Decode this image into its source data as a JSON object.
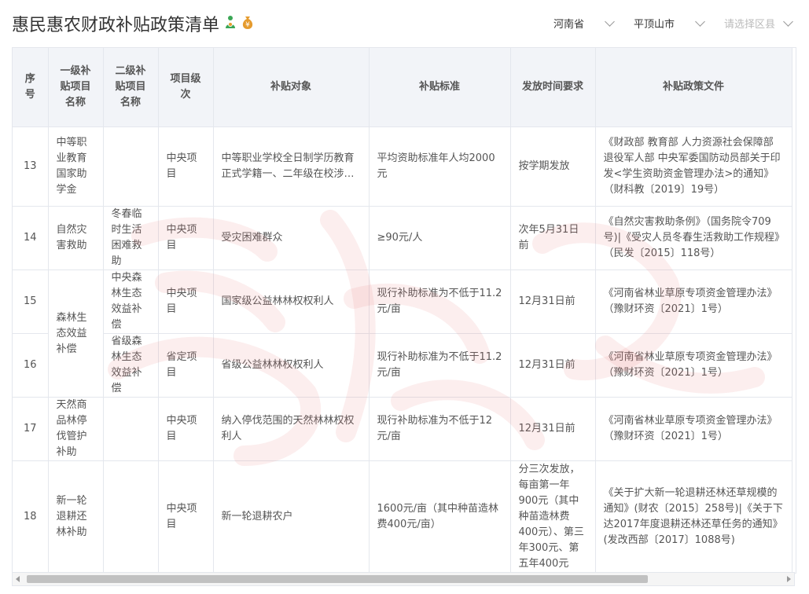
{
  "title": "惠民惠农财政补贴政策清单",
  "filters": {
    "province": "河南省",
    "city": "平顶山市",
    "county_placeholder": "请选择区县"
  },
  "columns": [
    "序号",
    "一级补贴项目名称",
    "二级补贴项目名称",
    "项目级次",
    "补贴对象",
    "补贴标准",
    "发放时间要求",
    "补贴政策文件"
  ],
  "rows": [
    {
      "no": "13",
      "l1": "中等职业教育国家助学金",
      "l2": "",
      "level": "中央项目",
      "target": "中等职业学校全日制学历教育正式学籍一、二年级在校涉农专...",
      "standard": "平均资助标准年人均2000元",
      "time": "按学期发放",
      "doc": "《财政部 教育部 人力资源社会保障部 退役军人部 中央军委国防动员部关于印发<学生资助资金管理办法>的通知》（财科教〔2019〕19号）"
    },
    {
      "no": "14",
      "l1": "自然灾害救助",
      "l2": "冬春临时生活困难救助",
      "level": "中央项目",
      "target": "受灾困难群众",
      "standard": "≥90元/人",
      "time": "次年5月31日前",
      "doc": "《自然灾害救助条例》（国务院令709号)|《受灾人员冬春生活救助工作规程》（民发〔2015〕118号）"
    },
    {
      "no": "15",
      "l1": "森林生态效益补偿",
      "l2": "中央森林生态效益补偿",
      "level": "中央项目",
      "target": "国家级公益林林权权利人",
      "standard": "现行补助标准为不低于11.2元/亩",
      "time": "12月31日前",
      "doc": "《河南省林业草原专项资金管理办法》（豫财环资〔2021〕1号）"
    },
    {
      "no": "16",
      "l1": "",
      "l2": "省级森林生态效益补偿",
      "level": "省定项目",
      "target": "省级公益林林权权利人",
      "standard": "现行补助标准为不低于11.2元/亩",
      "time": "12月31日前",
      "doc": "《河南省林业草原专项资金管理办法》（豫财环资〔2021〕1号）"
    },
    {
      "no": "17",
      "l1": "天然商品林停伐管护补助",
      "l2": "",
      "level": "中央项目",
      "target": "纳入停伐范围的天然林林权权利人",
      "standard": "现行补助标准为不低于12元/亩",
      "time": "12月31日前",
      "doc": "《河南省林业草原专项资金管理办法》（豫财环资〔2021〕1号）"
    },
    {
      "no": "18",
      "l1": "新一轮退耕还林补助",
      "l2": "",
      "level": "中央项目",
      "target": "新一轮退耕农户",
      "standard": "1600元/亩（其中种苗造林费400元/亩）",
      "time": "分三次发放，每亩第一年900元（其中种苗造林费400元）、第三年300元、第五年400元",
      "doc": "《关于扩大新一轮退耕还林还草规模的通知》(财农〔2015〕258号)|《关于下达2017年度退耕还林还草任务的通知》(发改西部〔2017〕1088号)"
    }
  ]
}
